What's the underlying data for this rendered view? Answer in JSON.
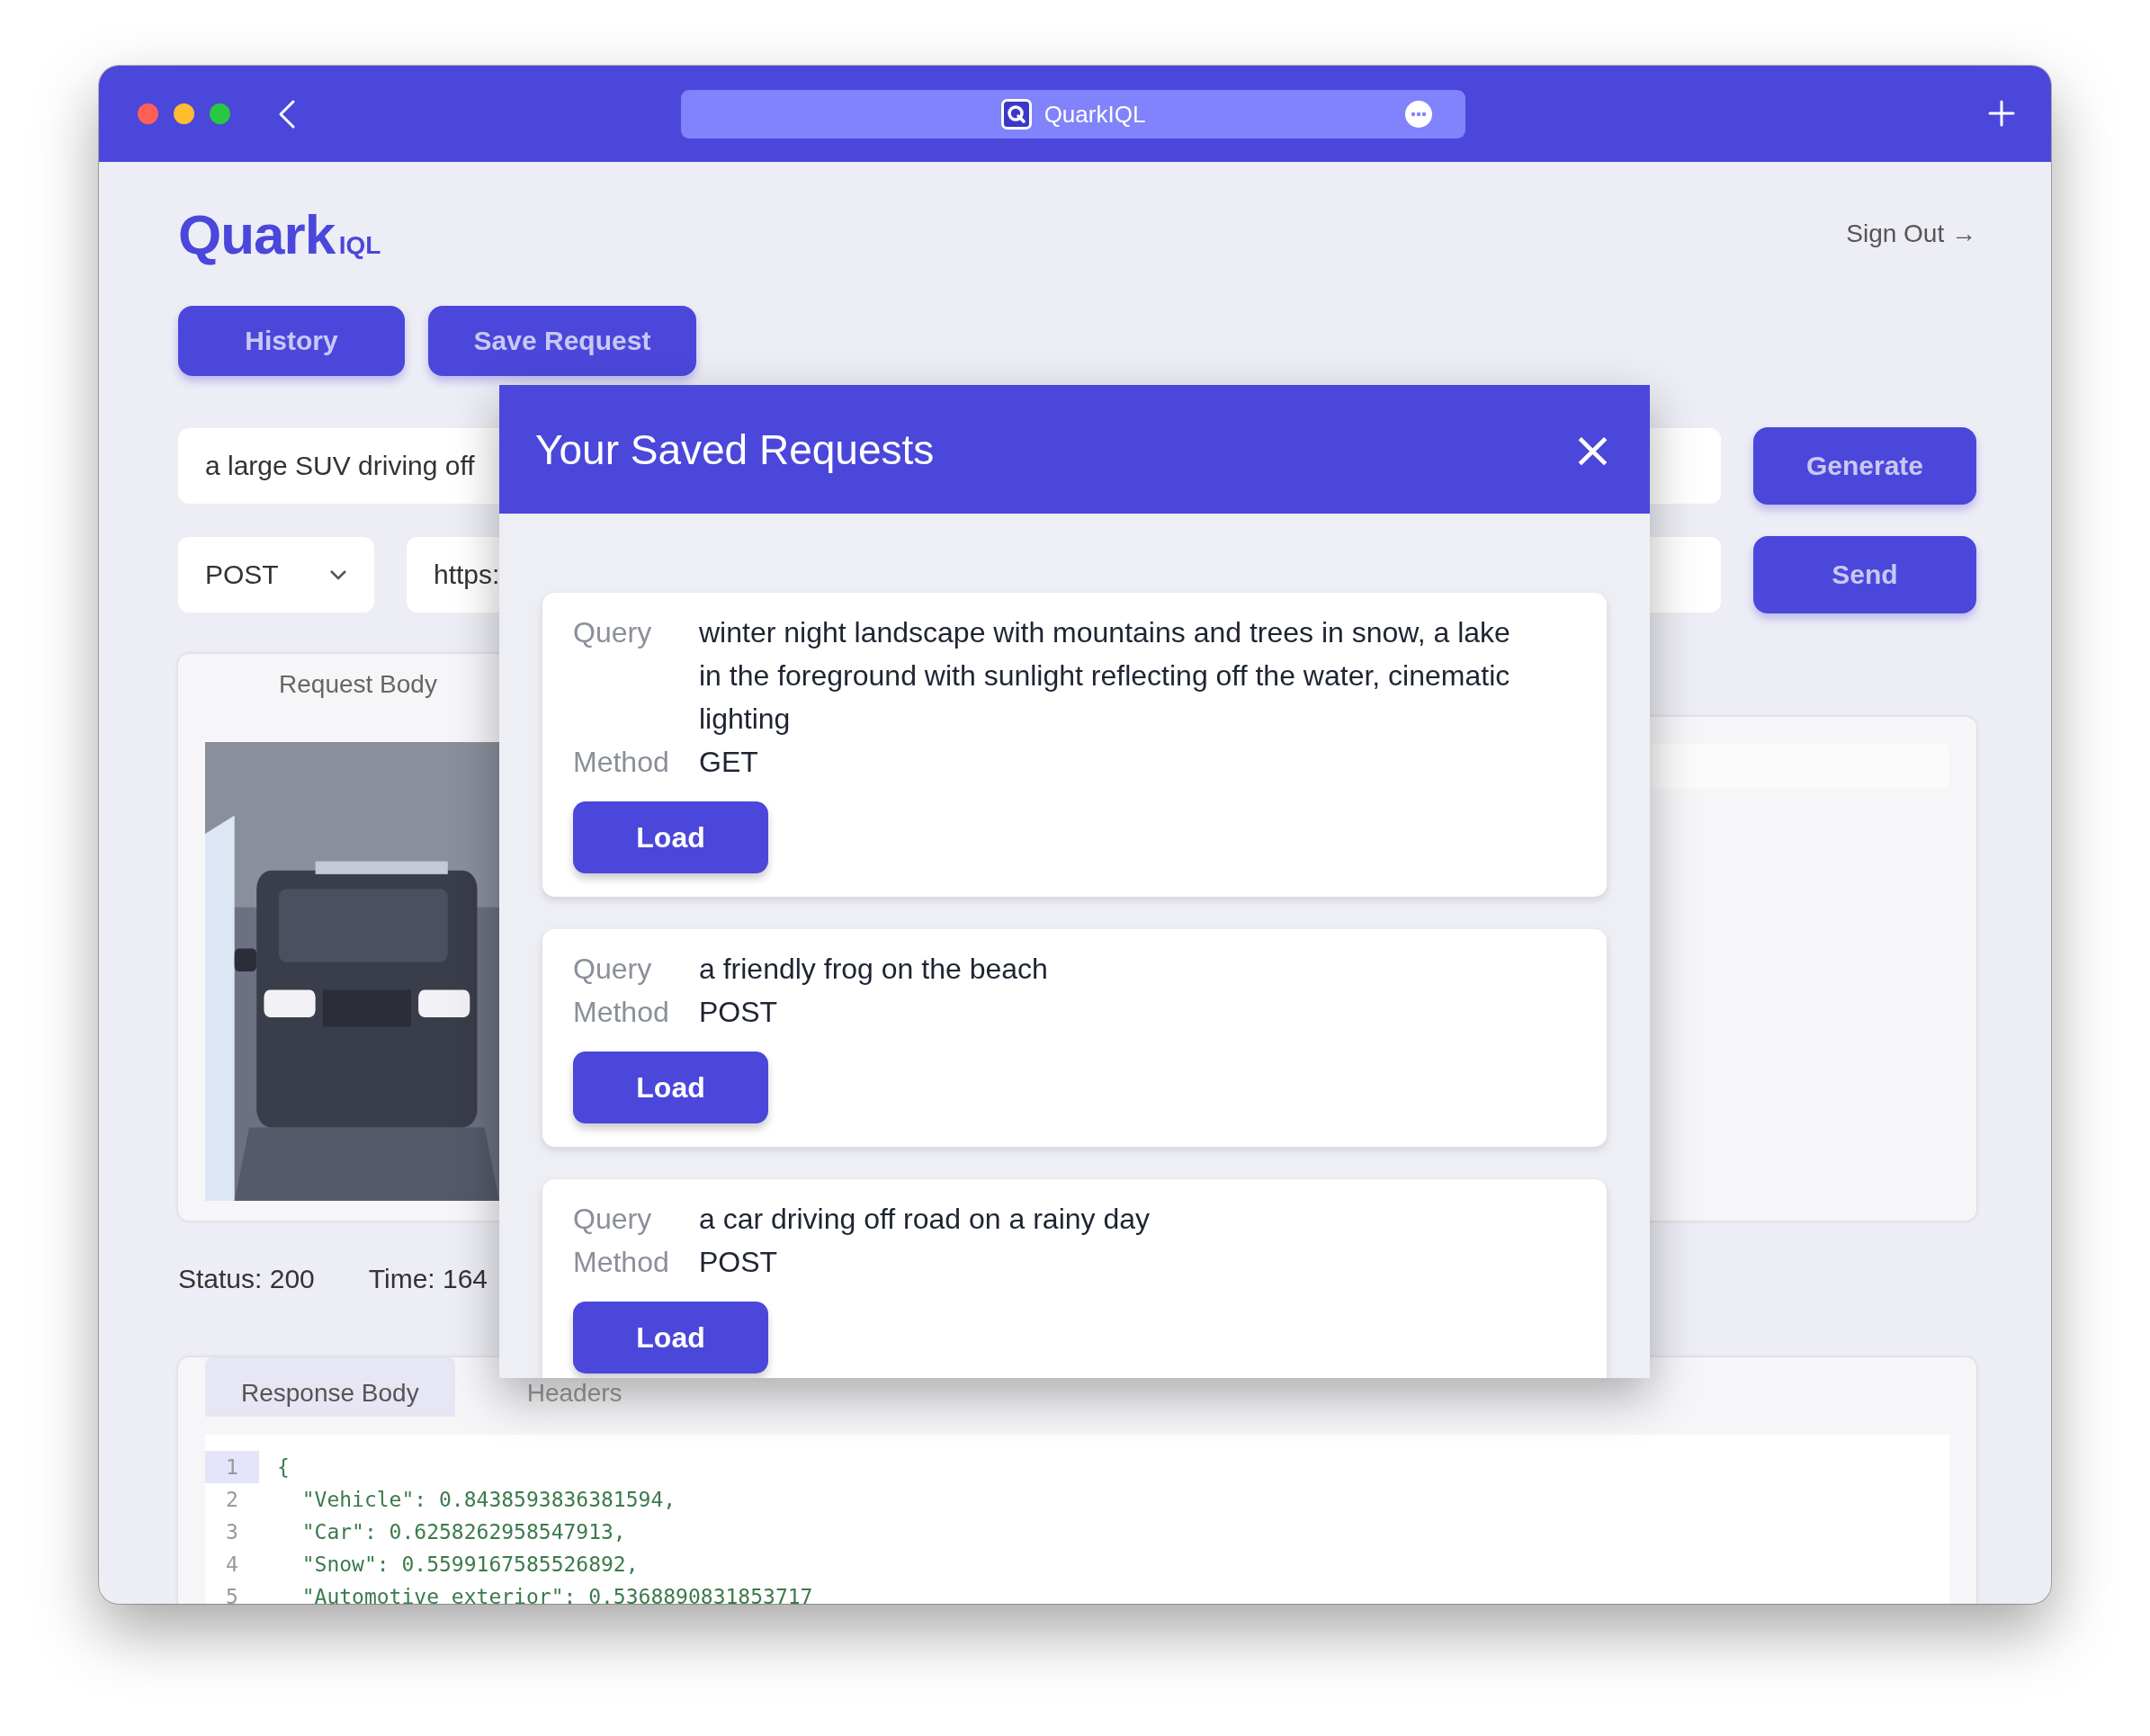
{
  "window": {
    "title": "QuarkIQL"
  },
  "app": {
    "logo": "Quark",
    "logo_suffix": "IQL",
    "sign_out": "Sign Out →",
    "buttons": [
      "History",
      "Save Request"
    ],
    "prompt": {
      "value": "a large SUV driving off"
    },
    "generate": "Generate",
    "method": {
      "value": "POST"
    },
    "url": {
      "value": "https:"
    },
    "send": "Send",
    "request_tab": "Request Body",
    "status": [
      "Status: 200",
      "Time: 164"
    ],
    "response_tabs": [
      {
        "label": "Response Body",
        "selected": true
      },
      {
        "label": "Headers",
        "selected": false
      }
    ],
    "code_lines": [
      {
        "number": "1",
        "text": "{"
      },
      {
        "number": "2",
        "text": "  \"Vehicle\": 0.8438593836381594,"
      },
      {
        "number": "3",
        "text": "  \"Car\": 0.6258262958547913,"
      },
      {
        "number": "4",
        "text": "  \"Snow\": 0.5599167585526892,"
      },
      {
        "number": "5",
        "text": "  \"Automotive exterior\": 0.5368890831853717"
      }
    ]
  },
  "modal": {
    "title": "Your Saved Requests",
    "close": "×",
    "requests": [
      {
        "query_label": "Query",
        "query": "winter night landscape with mountains and trees in snow, a lake in the foreground with sunlight reflecting off the water, cinematic lighting",
        "method_label": "Method",
        "method": "GET",
        "button": "Load"
      },
      {
        "query_label": "Query",
        "query": "a friendly frog on the beach",
        "method_label": "Method",
        "method": "POST",
        "button": "Load"
      },
      {
        "query_label": "Query",
        "query": "a car driving off road on a rainy day",
        "method_label": "Method",
        "method": "POST",
        "button": "Load"
      }
    ]
  }
}
